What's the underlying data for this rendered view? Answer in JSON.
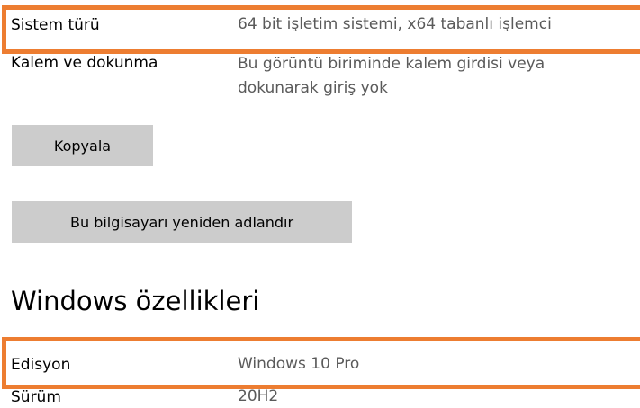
{
  "device_specs": {
    "system_type": {
      "label": "Sistem türü",
      "value": "64 bit işletim sistemi, x64 tabanlı işlemci"
    },
    "pen_and_touch": {
      "label": "Kalem ve dokunma",
      "value_line1": "Bu görüntü biriminde kalem girdisi veya",
      "value_line2": "dokunarak giriş yok"
    },
    "copy_button": "Kopyala",
    "rename_button": "Bu bilgisayarı yeniden adlandır"
  },
  "windows_specs": {
    "title": "Windows özellikleri",
    "edition": {
      "label": "Edisyon",
      "value": "Windows 10 Pro"
    },
    "version": {
      "label": "Sürüm",
      "value": "20H2"
    }
  },
  "colors": {
    "highlight": "#ed7d31",
    "button_bg": "#cccccc",
    "value_text": "#5a5a5a"
  }
}
